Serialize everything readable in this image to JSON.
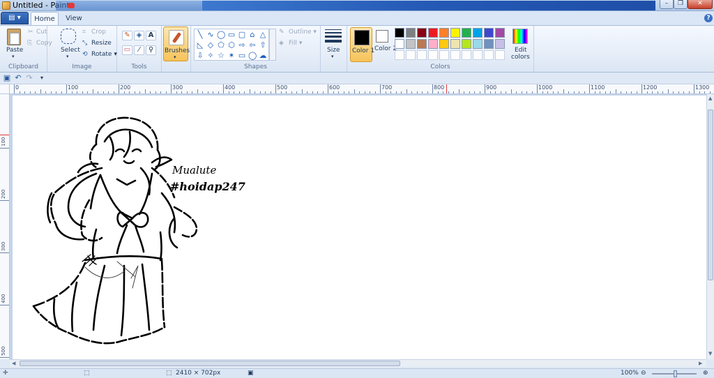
{
  "window": {
    "title": "Untitled - Paint",
    "min": "–",
    "max": "❐",
    "close": "✕",
    "help": "?"
  },
  "tabs": {
    "file": "▤ ▾",
    "home": "Home",
    "view": "View"
  },
  "clipboard": {
    "label": "Clipboard",
    "paste": "Paste",
    "cut": "Cut",
    "copy": "Copy"
  },
  "image": {
    "label": "Image",
    "select": "Select",
    "crop": "Crop",
    "resize": "Resize",
    "rotate": "Rotate ▾"
  },
  "tools": {
    "label": "Tools",
    "pencil": "✎",
    "fill": "◈",
    "text": "A",
    "eraser": "▭",
    "picker": "⁄",
    "magnifier": "⚲"
  },
  "brushes": {
    "label": "Brushes"
  },
  "shapes": {
    "label": "Shapes",
    "outline": "Outline ▾",
    "fill": "Fill ▾",
    "items": [
      "╲",
      "∿",
      "◯",
      "▭",
      "▢",
      "⌂",
      "△",
      "◺",
      "◇",
      "⬠",
      "⬡",
      "⇨",
      "⇦",
      "⇧",
      "⇩",
      "✧",
      "☆",
      "✶",
      "▭",
      "◯",
      "☁"
    ]
  },
  "size": {
    "label": "Size"
  },
  "colors": {
    "label": "Colors",
    "color1": "Color 1",
    "color2": "Color 2",
    "edit": "Edit colors",
    "row1": [
      "#000000",
      "#7f7f7f",
      "#880015",
      "#ed1c24",
      "#ff7f27",
      "#fff200",
      "#22b14c",
      "#00a2e8",
      "#3f48cc",
      "#a349a4"
    ],
    "row2": [
      "#ffffff",
      "#c3c3c3",
      "#b97a57",
      "#ffaec9",
      "#ffc90e",
      "#efe4b0",
      "#b5e61d",
      "#99d9ea",
      "#7092be",
      "#c8bfe7"
    ]
  },
  "ruler": {
    "h_labels": [
      "0",
      "100",
      "200",
      "300",
      "400",
      "500",
      "600",
      "700",
      "800",
      "900",
      "1000",
      "1100",
      "1200",
      "1300"
    ],
    "v_labels": [
      "100",
      "200",
      "300",
      "400",
      "500"
    ]
  },
  "drawing": {
    "caption1": "Mualute",
    "caption2": "#hoidap247"
  },
  "status": {
    "size": "2410 × 702px",
    "zoom": "100%",
    "minus": "⊖",
    "plus": "⊕"
  }
}
